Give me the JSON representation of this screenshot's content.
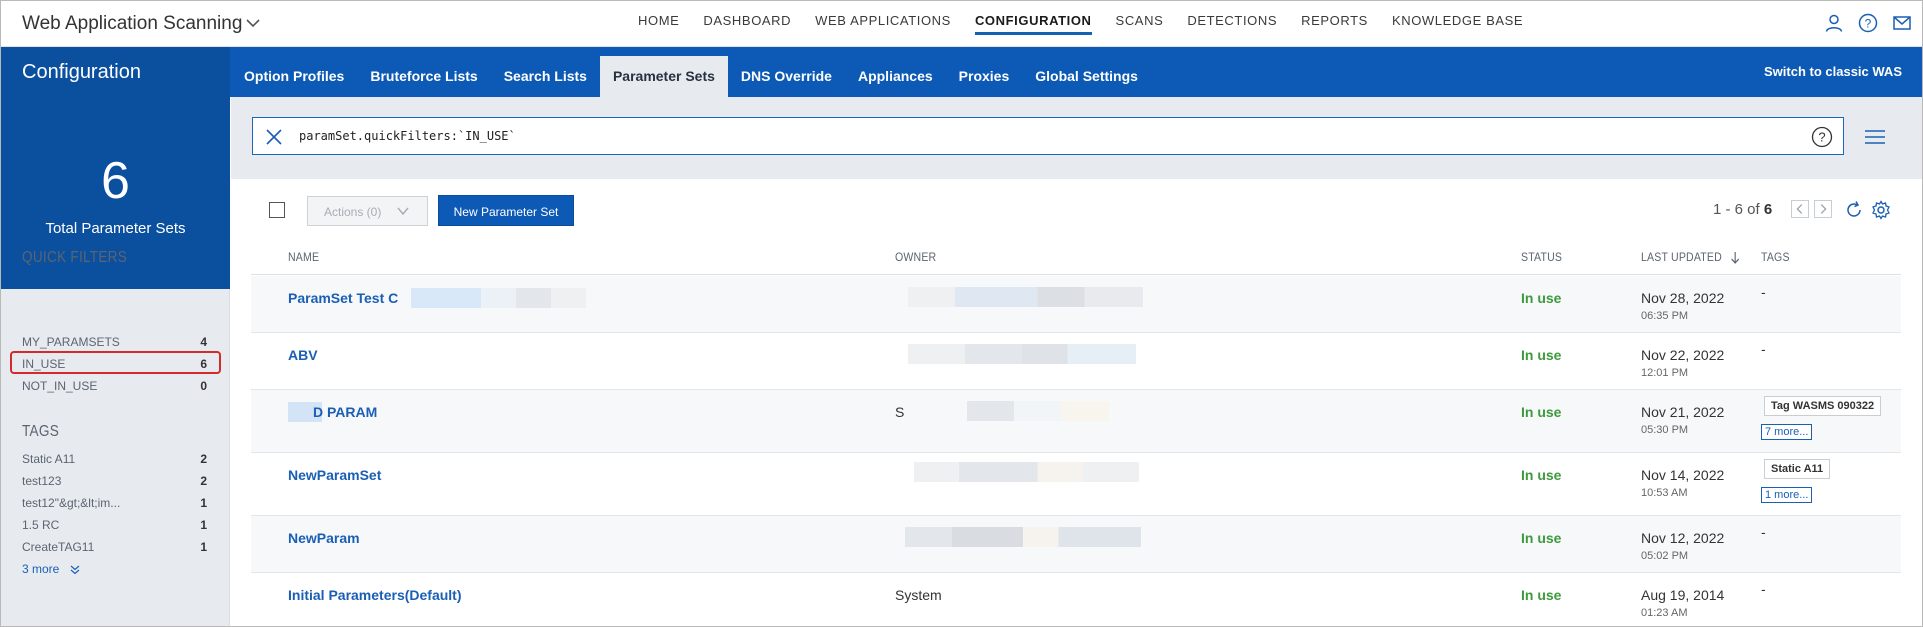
{
  "app": {
    "title": "Web Application Scanning"
  },
  "topnav": {
    "items": [
      "HOME",
      "DASHBOARD",
      "WEB APPLICATIONS",
      "CONFIGURATION",
      "SCANS",
      "DETECTIONS",
      "REPORTS",
      "KNOWLEDGE BASE"
    ],
    "active": "CONFIGURATION"
  },
  "section": {
    "title": "Configuration"
  },
  "subtabs": {
    "items": [
      "Option Profiles",
      "Bruteforce Lists",
      "Search Lists",
      "Parameter Sets",
      "DNS Override",
      "Appliances",
      "Proxies",
      "Global Settings"
    ],
    "active": "Parameter Sets"
  },
  "switch_classic": "Switch to classic WAS",
  "summary": {
    "total": "6",
    "label": "Total Parameter Sets"
  },
  "quick_filters": {
    "title": "QUICK FILTERS",
    "items": [
      {
        "label": "MY_PARAMSETS",
        "count": "4"
      },
      {
        "label": "IN_USE",
        "count": "6"
      },
      {
        "label": "NOT_IN_USE",
        "count": "0"
      }
    ]
  },
  "tags": {
    "title": "TAGS",
    "items": [
      {
        "label": "Static A11",
        "count": "2"
      },
      {
        "label": "test123",
        "count": "2"
      },
      {
        "label": "test12\"&gt;&lt;im...",
        "count": "1"
      },
      {
        "label": "1.5 RC",
        "count": "1"
      },
      {
        "label": "CreateTAG11",
        "count": "1"
      }
    ],
    "more": "3 more"
  },
  "search": {
    "query": "paramSet.quickFilters:`IN_USE`"
  },
  "toolbar": {
    "actions_label": "Actions (0)",
    "new_label": "New Parameter Set",
    "pager_prefix": "1 - 6 of",
    "pager_total": "6"
  },
  "table": {
    "columns": [
      "NAME",
      "OWNER",
      "STATUS",
      "LAST UPDATED",
      "TAGS"
    ],
    "rows": [
      {
        "name": "ParamSet Test C",
        "owner": "",
        "status": "In use",
        "date": "Nov 28, 2022",
        "time": "06:35 PM",
        "tags": "-",
        "tag_chip": "",
        "more": ""
      },
      {
        "name": "ABV",
        "owner": "",
        "status": "In use",
        "date": "Nov 22, 2022",
        "time": "12:01 PM",
        "tags": "-",
        "tag_chip": "",
        "more": ""
      },
      {
        "name": "D PARAM",
        "owner": "S",
        "status": "In use",
        "date": "Nov 21, 2022",
        "time": "05:30 PM",
        "tags": "",
        "tag_chip": "Tag WASMS 090322",
        "more": "7 more..."
      },
      {
        "name": "NewParamSet",
        "owner": "",
        "status": "In use",
        "date": "Nov 14, 2022",
        "time": "10:53 AM",
        "tags": "",
        "tag_chip": "Static A11",
        "more": "1 more..."
      },
      {
        "name": "NewParam",
        "owner": "",
        "status": "In use",
        "date": "Nov 12, 2022",
        "time": "05:02 PM",
        "tags": "-",
        "tag_chip": "",
        "more": ""
      },
      {
        "name": "Initial Parameters(Default)",
        "owner": "System",
        "status": "In use",
        "date": "Aug 19, 2014",
        "time": "01:23 AM",
        "tags": "-",
        "tag_chip": "",
        "more": ""
      }
    ]
  },
  "colors": {
    "brand_blue": "#0c5ab6",
    "link_blue": "#1a5fb4",
    "status_green": "#3d9a3d",
    "highlight_red": "#d32a2a"
  }
}
